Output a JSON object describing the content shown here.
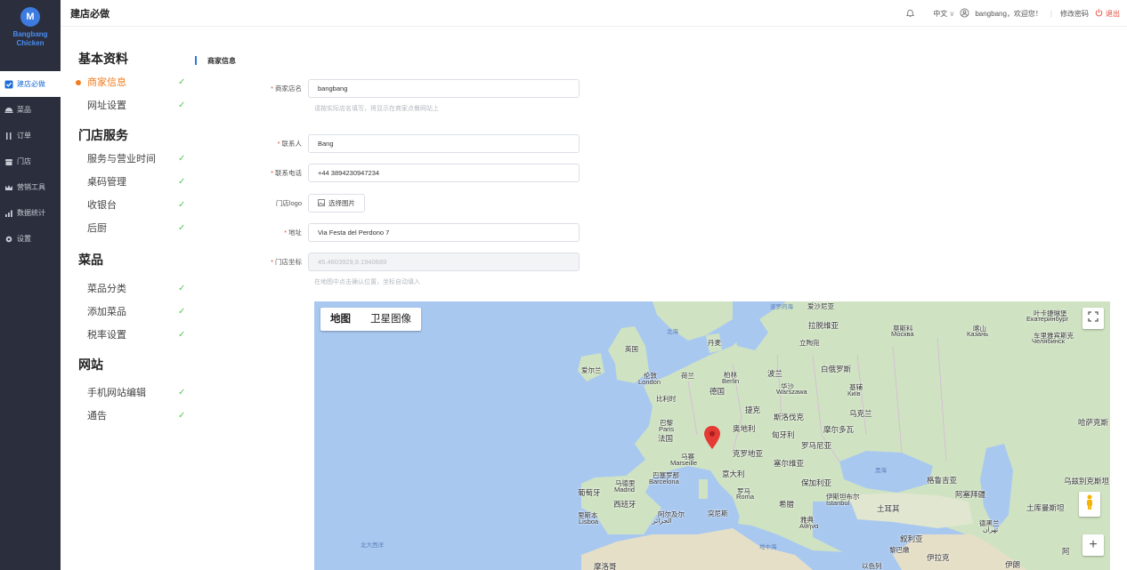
{
  "app": {
    "logo_letter": "M",
    "brand_name_line1": "Bangbang",
    "brand_name_line2": "Chicken",
    "page_title": "建店必做"
  },
  "sidebar": {
    "items": [
      {
        "label": "建店必做",
        "icon": "check-square-icon",
        "active": true
      },
      {
        "label": "菜品",
        "icon": "food-icon",
        "active": false
      },
      {
        "label": "订单",
        "icon": "utensils-icon",
        "active": false
      },
      {
        "label": "门店",
        "icon": "store-icon",
        "active": false
      },
      {
        "label": "营销工具",
        "icon": "crown-icon",
        "active": false
      },
      {
        "label": "数据统计",
        "icon": "chart-icon",
        "active": false
      },
      {
        "label": "设置",
        "icon": "gear-icon",
        "active": false
      }
    ]
  },
  "header": {
    "language": "中文",
    "greeting": "bangbang，欢迎您！",
    "change_password": "修改密码",
    "logout": "退出"
  },
  "menu": {
    "groups": [
      {
        "title": "基本资料",
        "items": [
          {
            "label": "商家信息",
            "current": true
          },
          {
            "label": "网址设置"
          }
        ]
      },
      {
        "title": "门店服务",
        "items": [
          {
            "label": "服务与营业时间"
          },
          {
            "label": "桌码管理"
          },
          {
            "label": "收银台"
          },
          {
            "label": "后厨"
          }
        ]
      },
      {
        "title": "菜品",
        "items": [
          {
            "label": "菜品分类"
          },
          {
            "label": "添加菜品"
          },
          {
            "label": "税率设置"
          }
        ]
      },
      {
        "title": "网站",
        "items": [
          {
            "label": "手机网站编辑"
          },
          {
            "label": "通告"
          }
        ]
      }
    ]
  },
  "form": {
    "section_title": "商家信息",
    "store_name_label": "商家店名",
    "store_name_value": "bangbang",
    "store_name_hint": "请按实际店名填写，将显示在商家点餐网站上",
    "contact_label": "联系人",
    "contact_value": "Bang",
    "phone_label": "联系电话",
    "phone_value": "+44 3894230947234",
    "logo_label": "门店logo",
    "logo_button": "选择图片",
    "address_label": "地址",
    "address_value": "Via Festa del Perdono 7",
    "coords_label": "门店坐标",
    "coords_value": "45.4603929,9.1940689",
    "coords_hint": "在地图中点击确认位置，坐标自动填入"
  },
  "map": {
    "tab_map": "地图",
    "tab_satellite": "卫星图像",
    "labels": [
      {
        "text": "波罗的海"
      },
      {
        "text": "爱沙尼亚"
      },
      {
        "text": "拉脱维亚"
      },
      {
        "text": "立陶宛"
      },
      {
        "text": "北海"
      },
      {
        "text": "丹麦"
      },
      {
        "text": "英国"
      },
      {
        "text": "爱尔兰"
      },
      {
        "text": "伦敦"
      },
      {
        "text": "London"
      },
      {
        "text": "荷兰"
      },
      {
        "text": "柏林"
      },
      {
        "text": "Berlin"
      },
      {
        "text": "德国"
      },
      {
        "text": "波兰"
      },
      {
        "text": "华沙"
      },
      {
        "text": "Warszawa"
      },
      {
        "text": "白俄罗斯"
      },
      {
        "text": "基辅"
      },
      {
        "text": "Київ"
      },
      {
        "text": "比利时"
      },
      {
        "text": "乌克兰"
      },
      {
        "text": "捷克"
      },
      {
        "text": "斯洛伐克"
      },
      {
        "text": "巴黎"
      },
      {
        "text": "Paris"
      },
      {
        "text": "法国"
      },
      {
        "text": "奥地利"
      },
      {
        "text": "匈牙利"
      },
      {
        "text": "摩尔多瓦"
      },
      {
        "text": "罗马尼亚"
      },
      {
        "text": "克罗地亚"
      },
      {
        "text": "塞尔维亚"
      },
      {
        "text": "马赛"
      },
      {
        "text": "Marseille"
      },
      {
        "text": "巴塞罗那"
      },
      {
        "text": "Barcelona"
      },
      {
        "text": "意大利"
      },
      {
        "text": "保加利亚"
      },
      {
        "text": "马德里"
      },
      {
        "text": "Madrid"
      },
      {
        "text": "葡萄牙"
      },
      {
        "text": "西班牙"
      },
      {
        "text": "罗马"
      },
      {
        "text": "Roma"
      },
      {
        "text": "伊斯坦布尔"
      },
      {
        "text": "İstanbul"
      },
      {
        "text": "希腊"
      },
      {
        "text": "雅典"
      },
      {
        "text": "Αθήνα"
      },
      {
        "text": "土耳其"
      },
      {
        "text": "里斯本"
      },
      {
        "text": "Lisboa"
      },
      {
        "text": "阿尔及尔"
      },
      {
        "text": "الجزائر"
      },
      {
        "text": "突尼斯"
      },
      {
        "text": "北大西洋"
      },
      {
        "text": "地中海"
      },
      {
        "text": "黑海"
      },
      {
        "text": "格鲁吉亚"
      },
      {
        "text": "阿塞拜疆"
      },
      {
        "text": "叙利亚"
      },
      {
        "text": "黎巴嫩"
      },
      {
        "text": "伊拉克"
      },
      {
        "text": "以色列"
      },
      {
        "text": "伊朗"
      },
      {
        "text": "摩洛哥"
      },
      {
        "text": "莫斯科"
      },
      {
        "text": "Москва"
      },
      {
        "text": "喀山"
      },
      {
        "text": "Казань"
      },
      {
        "text": "叶卡捷琳堡"
      },
      {
        "text": "Екатеринбург"
      },
      {
        "text": "车里雅宾斯克"
      },
      {
        "text": "Челябинск"
      },
      {
        "text": "哈萨克斯"
      },
      {
        "text": "乌兹别克斯坦"
      },
      {
        "text": "土库曼斯坦"
      },
      {
        "text": "德黑兰"
      },
      {
        "text": "تهران"
      },
      {
        "text": "阿"
      }
    ]
  },
  "colors": {
    "sidebar_bg": "#2b2f3d",
    "accent": "#1e6fd9",
    "current_menu": "#f07d20",
    "check": "#5bc65b",
    "required": "#e54b3c"
  }
}
